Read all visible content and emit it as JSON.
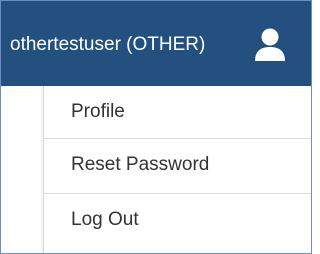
{
  "header": {
    "user_label": "othertestuser (OTHER)",
    "user_icon": "user-icon",
    "background_color": "#23507e"
  },
  "menu": {
    "items": [
      {
        "label": "Profile"
      },
      {
        "label": "Reset Password"
      },
      {
        "label": "Log Out"
      }
    ]
  }
}
